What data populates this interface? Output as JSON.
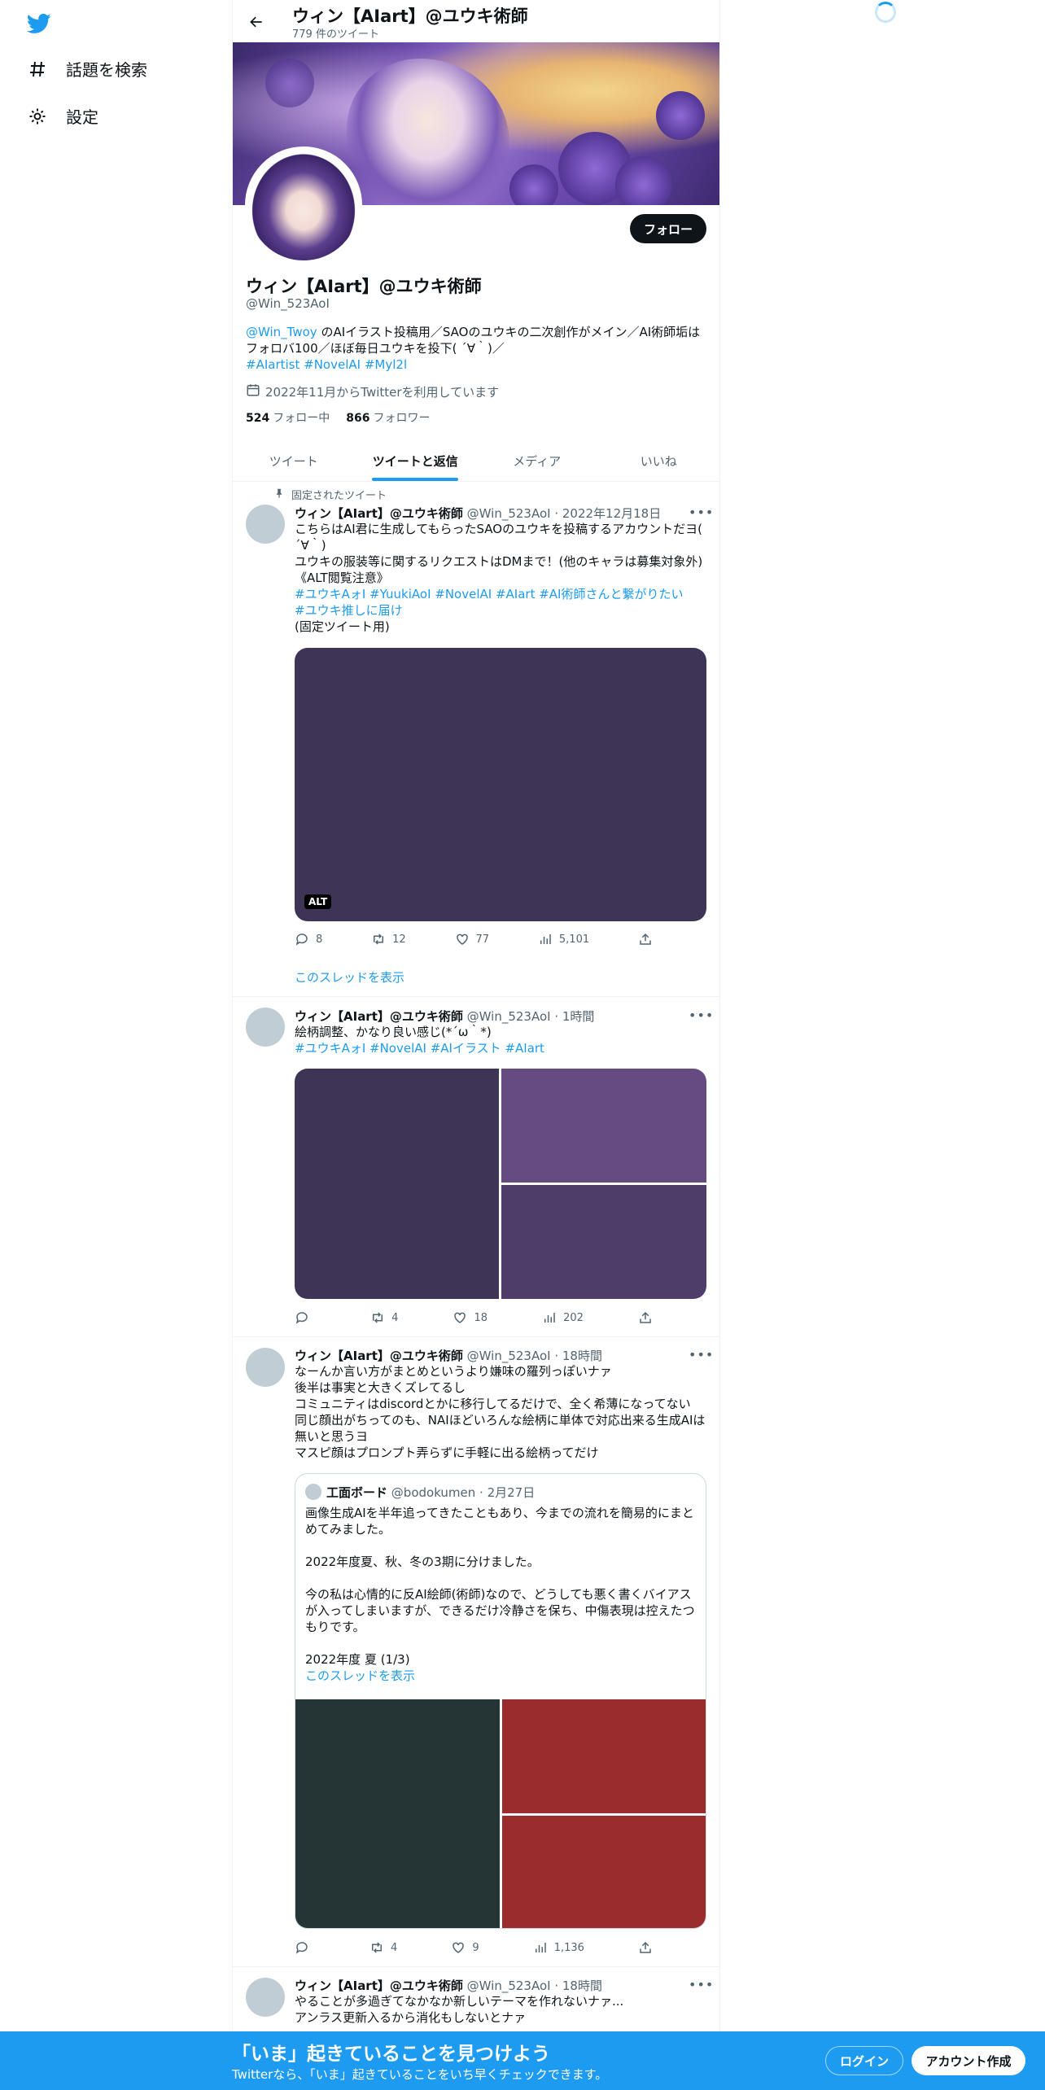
{
  "nav": {
    "items": [
      {
        "label": "話題を検索",
        "icon": "hashtag-icon"
      },
      {
        "label": "設定",
        "icon": "gear-icon"
      }
    ]
  },
  "header": {
    "title": "ウィン【AIart】@ユウキ術師",
    "subtitle": "779 件のツイート"
  },
  "profile": {
    "name": "ウィン【AIart】@ユウキ術師",
    "handle": "@Win_523AoI",
    "bio_mention": "@Win_Twoy",
    "bio_text_1": " のAIイラスト投稿用／SAOのユウキの二次創作がメイン／AI術師垢は",
    "bio_text_2": "フォロバ100／ほぼ毎日ユウキを投下( ´∀｀)／",
    "bio_tags": [
      "#AIartist",
      "#NovelAI",
      "#Myl2l"
    ],
    "joined": "2022年11月からTwitterを利用しています",
    "following_count": "524",
    "following_label": "フォロー中",
    "followers_count": "866",
    "followers_label": "フォロワー",
    "follow_button": "フォロー"
  },
  "tabs": [
    {
      "label": "ツイート",
      "active": false
    },
    {
      "label": "ツイートと返信",
      "active": true
    },
    {
      "label": "メディア",
      "active": false
    },
    {
      "label": "いいね",
      "active": false
    }
  ],
  "tweets": {
    "pinned_label": "固定されたツイート",
    "t1": {
      "name": "ウィン【AIart】@ユウキ術師",
      "meta": "@Win_523AoI · 2022年12月18日",
      "line1": "こちらはAI君に生成してもらったSAOのユウキを投稿するアカウントだヨ(",
      "line2": "´∀｀)",
      "line3": "ユウキの服装等に関するリクエストはDMまで！(他のキャラは募集対象外)",
      "line4": "《ALT閲覧注意》",
      "tags_1": "#ユウキAォI #YuukiAoI #NovelAI #AIart #AI術師さんと繋がりたい",
      "tags_2": "#ユウキ推しに届け",
      "line5": "(固定ツイート用)",
      "alt": "ALT",
      "replies": "8",
      "retweets": "12",
      "likes": "77",
      "views": "5,101",
      "show_thread": "このスレッドを表示"
    },
    "t2": {
      "name": "ウィン【AIart】@ユウキ術師",
      "meta": "@Win_523AoI · 1時間",
      "line1": "絵柄調整、かなり良い感じ(*´ω｀*)",
      "tags": "#ユウキAォI #NovelAI #AIイラスト #AIart",
      "replies": "",
      "retweets": "4",
      "likes": "18",
      "views": "202"
    },
    "t3": {
      "name": "ウィン【AIart】@ユウキ術師",
      "meta": "@Win_523AoI · 18時間",
      "line1": "なーんか言い方がまとめというより嫌味の羅列っぽいナァ",
      "line2": "後半は事実と大きくズレてるし",
      "line3": "コミュニティはdiscordとかに移行してるだけで、全く希薄になってない",
      "line4": "同じ顔出がちってのも、NAIほどいろんな絵柄に単体で対応出来る生成AIは",
      "line5": "無いと思うヨ",
      "line6": "マスピ顔はプロンプト弄らずに手軽に出る絵柄ってだけ",
      "quote": {
        "name": "工面ボード",
        "meta": "@bodokumen · 2月27日",
        "q1": "画像生成AIを半年追ってきたこともあり、今までの流れを簡易的にまと",
        "q2": "めてみました。",
        "q3": "2022年度夏、秋、冬の3期に分けました。",
        "q4": "今の私は心情的に反AI絵師(術師)なので、どうしても悪く書くバイアス",
        "q5": "が入ってしまいますが、できるだけ冷静さを保ち、中傷表現は控えたつ",
        "q6": "もりです。",
        "q7": "2022年度 夏 (1/3)",
        "show_thread": "このスレッドを表示"
      },
      "replies": "",
      "retweets": "4",
      "likes": "9",
      "views": "1,136"
    },
    "t4": {
      "name": "ウィン【AIart】@ユウキ術師",
      "meta": "@Win_523AoI · 18時間",
      "line1": "やることが多過ぎてなかなか新しいテーマを作れないナァ...",
      "line2": "アンラス更新入るから消化もしないとナァ"
    }
  },
  "colors": {
    "accent": "#1d9bf0",
    "media_purple_dark": "#3e3455",
    "media_purple_mid": "#654b7f",
    "media_purple_2": "#4d3d68",
    "media_dark_green": "#253434",
    "media_red": "#9b2c2e"
  },
  "bottom_bar": {
    "title": "「いま」起きていることを見つけよう",
    "subtitle": "Twitterなら、「いま」起きていることをいち早くチェックできます。",
    "login": "ログイン",
    "signup": "アカウント作成"
  }
}
